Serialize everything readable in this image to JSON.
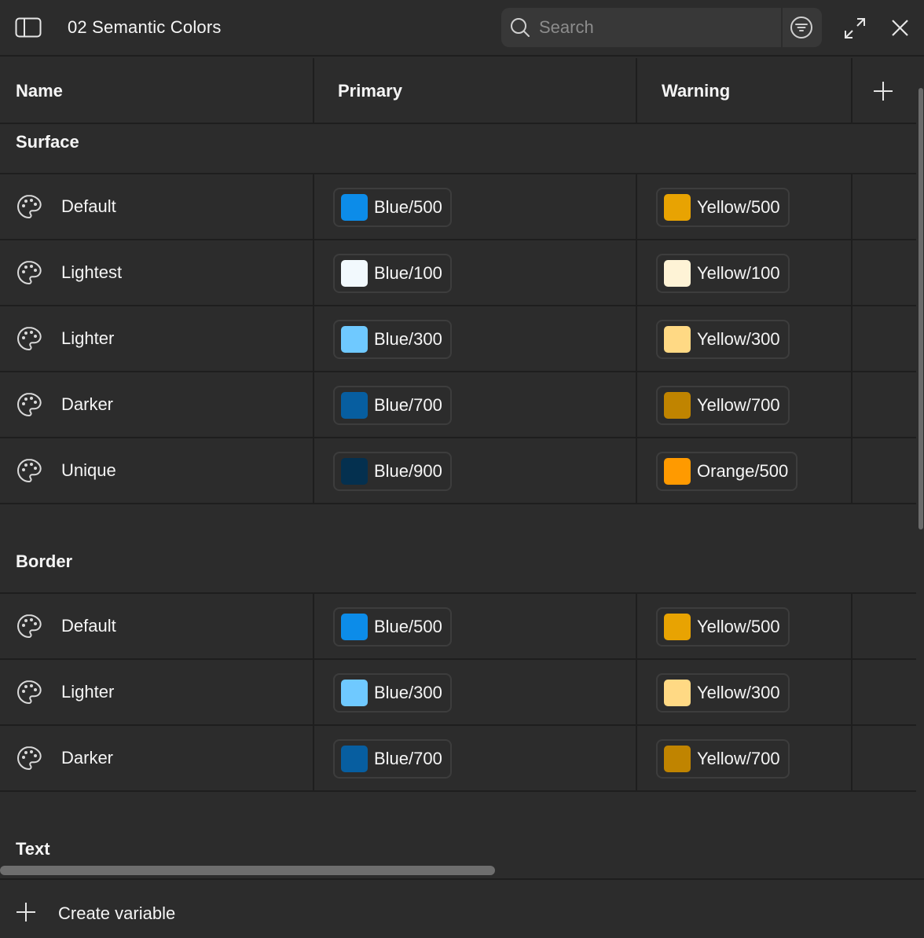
{
  "header": {
    "title": "02 Semantic Colors",
    "search_placeholder": "Search",
    "icons": [
      "sidebar-icon",
      "search-icon",
      "filter-icon",
      "expand-icon",
      "close-icon"
    ]
  },
  "columns": {
    "name": "Name",
    "primary": "Primary",
    "warning": "Warning"
  },
  "groups": [
    {
      "title": "Surface",
      "rows": [
        {
          "name": "Default",
          "primary": {
            "label": "Blue/500",
            "color": "#0c8ce9"
          },
          "warning": {
            "label": "Yellow/500",
            "color": "#e8a302"
          }
        },
        {
          "name": "Lightest",
          "primary": {
            "label": "Blue/100",
            "color": "#f2f9fd"
          },
          "warning": {
            "label": "Yellow/100",
            "color": "#fef3d6"
          }
        },
        {
          "name": "Lighter",
          "primary": {
            "label": "Blue/300",
            "color": "#6fc9ff"
          },
          "warning": {
            "label": "Yellow/300",
            "color": "#ffd984"
          }
        },
        {
          "name": "Darker",
          "primary": {
            "label": "Blue/700",
            "color": "#075ea0"
          },
          "warning": {
            "label": "Yellow/700",
            "color": "#c08400"
          }
        },
        {
          "name": "Unique",
          "primary": {
            "label": "Blue/900",
            "color": "#04304f"
          },
          "warning": {
            "label": "Orange/500",
            "color": "#ff9a00"
          }
        }
      ]
    },
    {
      "title": "Border",
      "rows": [
        {
          "name": "Default",
          "primary": {
            "label": "Blue/500",
            "color": "#0c8ce9"
          },
          "warning": {
            "label": "Yellow/500",
            "color": "#e8a302"
          }
        },
        {
          "name": "Lighter",
          "primary": {
            "label": "Blue/300",
            "color": "#6fc9ff"
          },
          "warning": {
            "label": "Yellow/300",
            "color": "#ffd984"
          }
        },
        {
          "name": "Darker",
          "primary": {
            "label": "Blue/700",
            "color": "#075ea0"
          },
          "warning": {
            "label": "Yellow/700",
            "color": "#c08400"
          }
        }
      ]
    },
    {
      "title": "Text",
      "rows": []
    }
  ],
  "footer": {
    "create_label": "Create variable"
  },
  "colors": {
    "background": "#2c2c2c",
    "divider": "#1e1e1e",
    "search_bg": "#383838",
    "chip_border": "#3d3d3d"
  }
}
